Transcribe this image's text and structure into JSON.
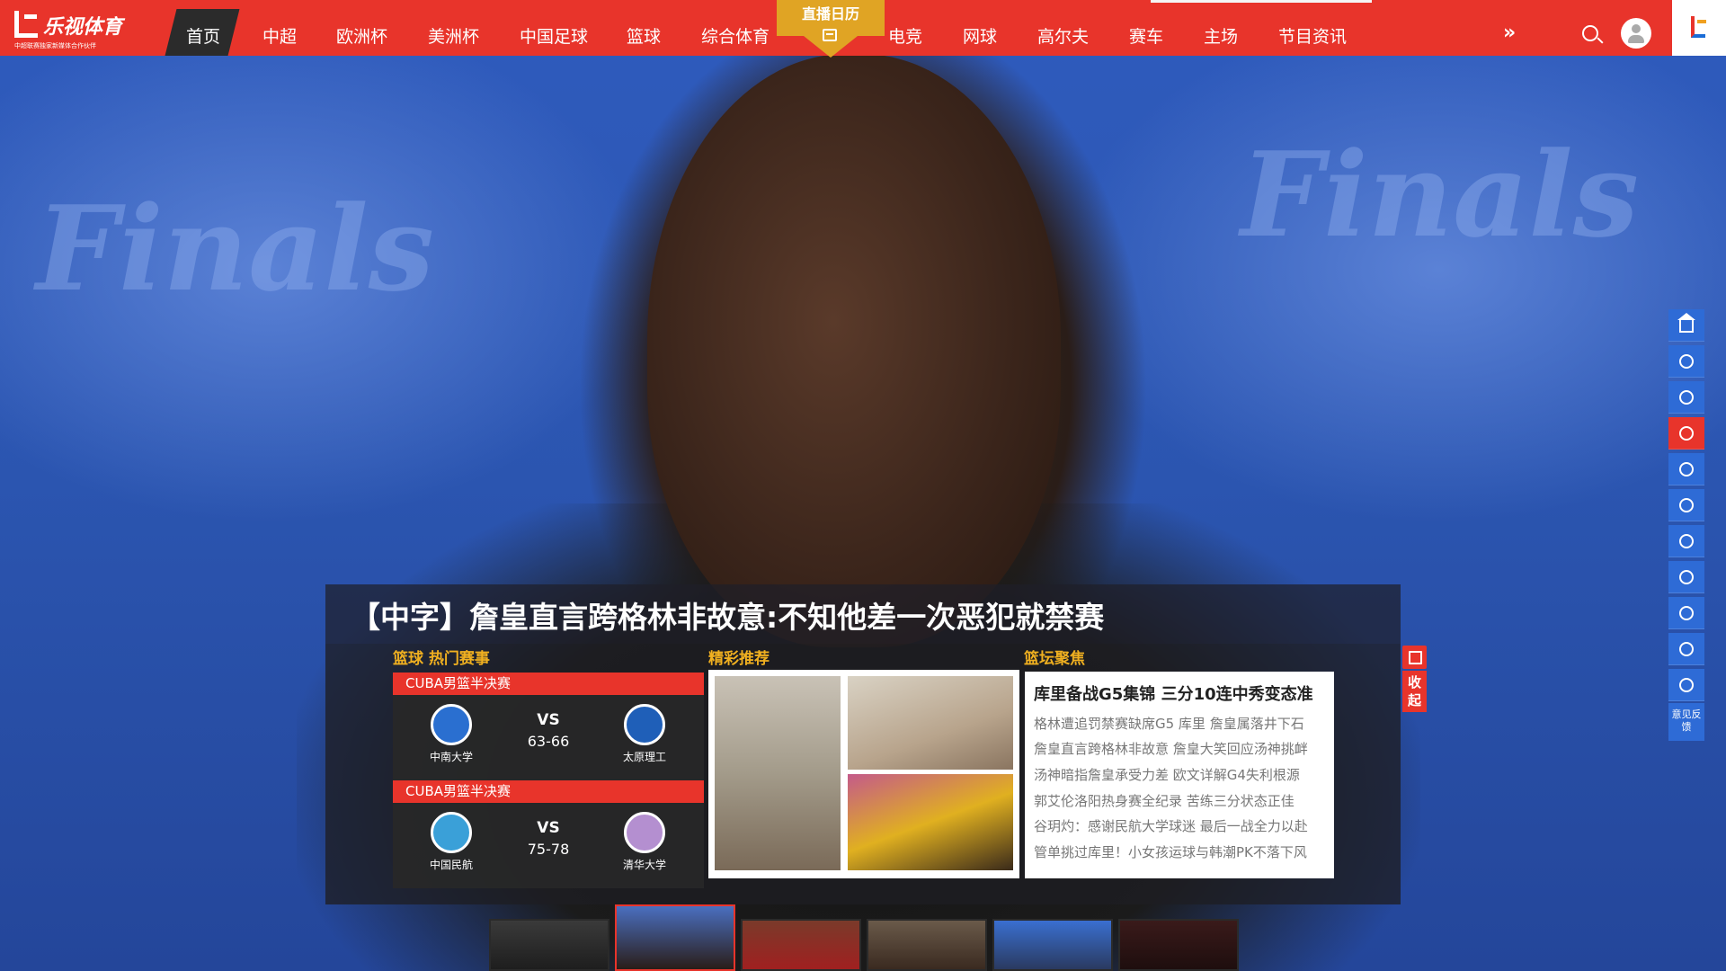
{
  "brand": {
    "name": "乐视体育",
    "tagline": "中超联赛独家新媒体合作伙伴",
    "accent": "#e8342b",
    "gold": "#f0b020"
  },
  "nav": {
    "home": "首页",
    "items": [
      "中超",
      "欧洲杯",
      "美洲杯",
      "中国足球",
      "篮球",
      "综合体育",
      "电竞",
      "网球",
      "高尔夫",
      "赛车",
      "主场",
      "节目资讯"
    ],
    "calendar": "直播日历",
    "more_icon": "»"
  },
  "hero": {
    "headline": "【中字】詹皇直言跨格林非故意:不知他差一次恶犯就禁赛"
  },
  "sections": {
    "hot": "篮球 热门赛事",
    "recommend": "精彩推荐",
    "focus": "篮坛聚焦"
  },
  "matches": [
    {
      "league": "CUBA男篮半决赛",
      "home": "中南大学",
      "away": "太原理工",
      "vs": "VS",
      "score": "63-66"
    },
    {
      "league": "CUBA男篮半决赛",
      "home": "中国民航",
      "away": "清华大学",
      "vs": "VS",
      "score": "75-78"
    }
  ],
  "focus": {
    "title": "库里备战G5集锦 三分10连中秀变态准",
    "lines": [
      "格林遭追罚禁赛缺席G5 库里 詹皇属落井下石",
      "詹皇直言跨格林非故意 詹皇大笑回应汤神挑衅",
      "汤神暗指詹皇承受力差 欧文详解G4失利根源",
      "郭艾伦洛阳热身赛全纪录 苦练三分状态正佳",
      "谷玥灼：感谢民航大学球迷 最后一战全力以赴",
      "管单挑过库里！小女孩运球与韩潮PK不落下风"
    ]
  },
  "side": {
    "collapse": "收起",
    "feedback": "意见反馈"
  }
}
